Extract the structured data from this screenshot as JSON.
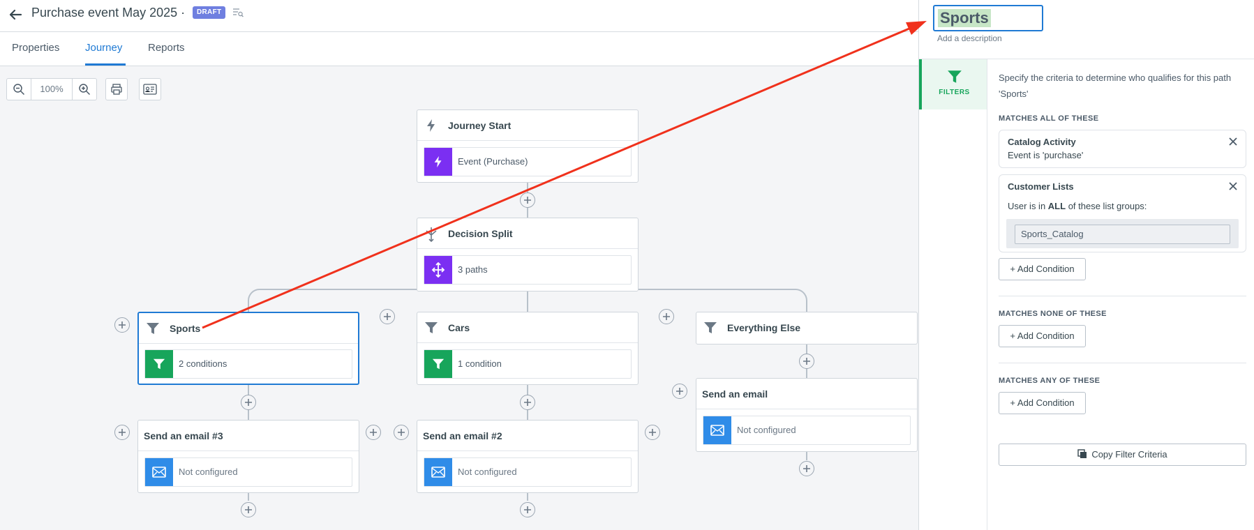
{
  "header": {
    "title": "Purchase event May 2025 ·",
    "status_badge": "DRAFT"
  },
  "tabs": [
    {
      "label": "Properties"
    },
    {
      "label": "Journey"
    },
    {
      "label": "Reports"
    }
  ],
  "toolbar": {
    "zoom_level": "100%"
  },
  "nodes": {
    "journey_start": {
      "title": "Journey Start",
      "body": "Event (Purchase)"
    },
    "decision_split": {
      "title": "Decision Split",
      "body": "3 paths"
    },
    "sports": {
      "title": "Sports",
      "body": "2 conditions"
    },
    "cars": {
      "title": "Cars",
      "body": "1 condition"
    },
    "everything_else": {
      "title": "Everything Else"
    },
    "email_3": {
      "title": "Send an email #3",
      "body": "Not configured"
    },
    "email_2": {
      "title": "Send an email #2",
      "body": "Not configured"
    },
    "email": {
      "title": "Send an email",
      "body": "Not configured"
    }
  },
  "panel": {
    "name_value": "Sports",
    "add_description": "Add a description",
    "side_tab_label": "FILTERS",
    "description": "Specify the criteria to determine who qualifies for this path 'Sports'",
    "matches_all_label": "MATCHES ALL OF THESE",
    "condition_1": {
      "title": "Catalog Activity",
      "detail": "Event is 'purchase'"
    },
    "condition_2": {
      "title": "Customer Lists",
      "detail_prefix": "User is in ",
      "detail_bold": "ALL",
      "detail_suffix": " of these list groups:",
      "list_value": "Sports_Catalog"
    },
    "add_condition_label": "+ Add Condition",
    "matches_none_label": "MATCHES NONE OF THESE",
    "matches_any_label": "MATCHES ANY OF THESE",
    "copy_filter_label": "Copy Filter Criteria"
  },
  "colors": {
    "accent": "#1f7ad4",
    "filter_green": "#17a55b",
    "event_purple": "#7b2ff2",
    "email_blue": "#2f8ce8",
    "annotation_arrow": "#f0311c"
  }
}
